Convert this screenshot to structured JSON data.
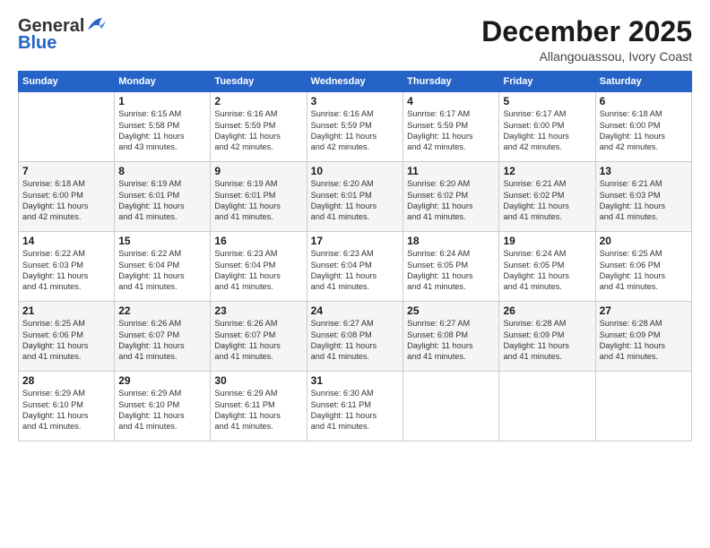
{
  "logo": {
    "general": "General",
    "blue": "Blue"
  },
  "title": "December 2025",
  "subtitle": "Allangouassou, Ivory Coast",
  "weekdays": [
    "Sunday",
    "Monday",
    "Tuesday",
    "Wednesday",
    "Thursday",
    "Friday",
    "Saturday"
  ],
  "weeks": [
    [
      {
        "day": "",
        "info": ""
      },
      {
        "day": "1",
        "info": "Sunrise: 6:15 AM\nSunset: 5:58 PM\nDaylight: 11 hours\nand 43 minutes."
      },
      {
        "day": "2",
        "info": "Sunrise: 6:16 AM\nSunset: 5:59 PM\nDaylight: 11 hours\nand 42 minutes."
      },
      {
        "day": "3",
        "info": "Sunrise: 6:16 AM\nSunset: 5:59 PM\nDaylight: 11 hours\nand 42 minutes."
      },
      {
        "day": "4",
        "info": "Sunrise: 6:17 AM\nSunset: 5:59 PM\nDaylight: 11 hours\nand 42 minutes."
      },
      {
        "day": "5",
        "info": "Sunrise: 6:17 AM\nSunset: 6:00 PM\nDaylight: 11 hours\nand 42 minutes."
      },
      {
        "day": "6",
        "info": "Sunrise: 6:18 AM\nSunset: 6:00 PM\nDaylight: 11 hours\nand 42 minutes."
      }
    ],
    [
      {
        "day": "7",
        "info": "Sunrise: 6:18 AM\nSunset: 6:00 PM\nDaylight: 11 hours\nand 42 minutes."
      },
      {
        "day": "8",
        "info": "Sunrise: 6:19 AM\nSunset: 6:01 PM\nDaylight: 11 hours\nand 41 minutes."
      },
      {
        "day": "9",
        "info": "Sunrise: 6:19 AM\nSunset: 6:01 PM\nDaylight: 11 hours\nand 41 minutes."
      },
      {
        "day": "10",
        "info": "Sunrise: 6:20 AM\nSunset: 6:01 PM\nDaylight: 11 hours\nand 41 minutes."
      },
      {
        "day": "11",
        "info": "Sunrise: 6:20 AM\nSunset: 6:02 PM\nDaylight: 11 hours\nand 41 minutes."
      },
      {
        "day": "12",
        "info": "Sunrise: 6:21 AM\nSunset: 6:02 PM\nDaylight: 11 hours\nand 41 minutes."
      },
      {
        "day": "13",
        "info": "Sunrise: 6:21 AM\nSunset: 6:03 PM\nDaylight: 11 hours\nand 41 minutes."
      }
    ],
    [
      {
        "day": "14",
        "info": "Sunrise: 6:22 AM\nSunset: 6:03 PM\nDaylight: 11 hours\nand 41 minutes."
      },
      {
        "day": "15",
        "info": "Sunrise: 6:22 AM\nSunset: 6:04 PM\nDaylight: 11 hours\nand 41 minutes."
      },
      {
        "day": "16",
        "info": "Sunrise: 6:23 AM\nSunset: 6:04 PM\nDaylight: 11 hours\nand 41 minutes."
      },
      {
        "day": "17",
        "info": "Sunrise: 6:23 AM\nSunset: 6:04 PM\nDaylight: 11 hours\nand 41 minutes."
      },
      {
        "day": "18",
        "info": "Sunrise: 6:24 AM\nSunset: 6:05 PM\nDaylight: 11 hours\nand 41 minutes."
      },
      {
        "day": "19",
        "info": "Sunrise: 6:24 AM\nSunset: 6:05 PM\nDaylight: 11 hours\nand 41 minutes."
      },
      {
        "day": "20",
        "info": "Sunrise: 6:25 AM\nSunset: 6:06 PM\nDaylight: 11 hours\nand 41 minutes."
      }
    ],
    [
      {
        "day": "21",
        "info": "Sunrise: 6:25 AM\nSunset: 6:06 PM\nDaylight: 11 hours\nand 41 minutes."
      },
      {
        "day": "22",
        "info": "Sunrise: 6:26 AM\nSunset: 6:07 PM\nDaylight: 11 hours\nand 41 minutes."
      },
      {
        "day": "23",
        "info": "Sunrise: 6:26 AM\nSunset: 6:07 PM\nDaylight: 11 hours\nand 41 minutes."
      },
      {
        "day": "24",
        "info": "Sunrise: 6:27 AM\nSunset: 6:08 PM\nDaylight: 11 hours\nand 41 minutes."
      },
      {
        "day": "25",
        "info": "Sunrise: 6:27 AM\nSunset: 6:08 PM\nDaylight: 11 hours\nand 41 minutes."
      },
      {
        "day": "26",
        "info": "Sunrise: 6:28 AM\nSunset: 6:09 PM\nDaylight: 11 hours\nand 41 minutes."
      },
      {
        "day": "27",
        "info": "Sunrise: 6:28 AM\nSunset: 6:09 PM\nDaylight: 11 hours\nand 41 minutes."
      }
    ],
    [
      {
        "day": "28",
        "info": "Sunrise: 6:29 AM\nSunset: 6:10 PM\nDaylight: 11 hours\nand 41 minutes."
      },
      {
        "day": "29",
        "info": "Sunrise: 6:29 AM\nSunset: 6:10 PM\nDaylight: 11 hours\nand 41 minutes."
      },
      {
        "day": "30",
        "info": "Sunrise: 6:29 AM\nSunset: 6:11 PM\nDaylight: 11 hours\nand 41 minutes."
      },
      {
        "day": "31",
        "info": "Sunrise: 6:30 AM\nSunset: 6:11 PM\nDaylight: 11 hours\nand 41 minutes."
      },
      {
        "day": "",
        "info": ""
      },
      {
        "day": "",
        "info": ""
      },
      {
        "day": "",
        "info": ""
      }
    ]
  ]
}
